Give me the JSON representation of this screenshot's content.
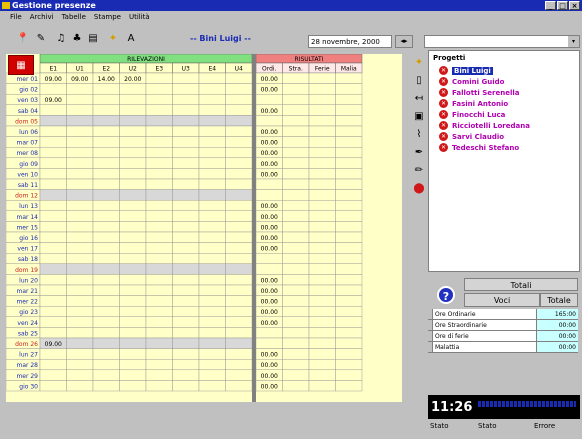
{
  "window": {
    "title": "Gestione presenze",
    "controls": [
      "_",
      "□",
      "×"
    ]
  },
  "menu": [
    "File",
    "Archivi",
    "Tabelle",
    "Stampe",
    "Utilità"
  ],
  "toolbar": {
    "user_label": "-- Bini Luigi --",
    "date_value": "28 novembre, 2000",
    "spin_label": "◂▸",
    "combo_arrow": "▾",
    "icons": [
      "pin-icon",
      "tag-icon",
      "bell-icon",
      "car-icon",
      "printer-icon",
      "star-icon",
      "text-icon"
    ]
  },
  "grid": {
    "group_headers": [
      "RILEVAZIONI",
      "RISULTATI"
    ],
    "columns": [
      "E1",
      "U1",
      "E2",
      "U2",
      "E3",
      "U3",
      "E4",
      "U4",
      "Ordi.",
      "Stra.",
      "Ferie",
      "Malia"
    ],
    "rows": [
      {
        "day": "mer 01",
        "cells": [
          "09.00",
          "09.00",
          "14.00",
          "20.00",
          "",
          "",
          "",
          "",
          "00.00",
          "",
          "",
          ""
        ],
        "holiday": false
      },
      {
        "day": "gio 02",
        "cells": [
          "",
          "",
          "",
          "",
          "",
          "",
          "",
          "",
          "00.00",
          "",
          "",
          ""
        ],
        "holiday": false
      },
      {
        "day": "ven 03",
        "cells": [
          "09.00",
          "",
          "",
          "",
          "",
          "",
          "",
          "",
          "",
          "",
          "",
          ""
        ],
        "holiday": false
      },
      {
        "day": "sab 04",
        "cells": [
          "",
          "",
          "",
          "",
          "",
          "",
          "",
          "",
          "00.00",
          "",
          "",
          ""
        ],
        "holiday": false
      },
      {
        "day": "dom 05",
        "cells": [
          "",
          "",
          "",
          "",
          "",
          "",
          "",
          "",
          "",
          "",
          "",
          ""
        ],
        "holiday": true
      },
      {
        "day": "lun 06",
        "cells": [
          "",
          "",
          "",
          "",
          "",
          "",
          "",
          "",
          "00.00",
          "",
          "",
          ""
        ],
        "holiday": false
      },
      {
        "day": "mar 07",
        "cells": [
          "",
          "",
          "",
          "",
          "",
          "",
          "",
          "",
          "00.00",
          "",
          "",
          ""
        ],
        "holiday": false
      },
      {
        "day": "mer 08",
        "cells": [
          "",
          "",
          "",
          "",
          "",
          "",
          "",
          "",
          "00.00",
          "",
          "",
          ""
        ],
        "holiday": false
      },
      {
        "day": "gio 09",
        "cells": [
          "",
          "",
          "",
          "",
          "",
          "",
          "",
          "",
          "00.00",
          "",
          "",
          ""
        ],
        "holiday": false
      },
      {
        "day": "ven 10",
        "cells": [
          "",
          "",
          "",
          "",
          "",
          "",
          "",
          "",
          "00.00",
          "",
          "",
          ""
        ],
        "holiday": false
      },
      {
        "day": "sab 11",
        "cells": [
          "",
          "",
          "",
          "",
          "",
          "",
          "",
          "",
          "",
          "",
          "",
          ""
        ],
        "holiday": false
      },
      {
        "day": "dom 12",
        "cells": [
          "",
          "",
          "",
          "",
          "",
          "",
          "",
          "",
          "",
          "",
          "",
          ""
        ],
        "holiday": true
      },
      {
        "day": "lun 13",
        "cells": [
          "",
          "",
          "",
          "",
          "",
          "",
          "",
          "",
          "00.00",
          "",
          "",
          ""
        ],
        "holiday": false
      },
      {
        "day": "mar 14",
        "cells": [
          "",
          "",
          "",
          "",
          "",
          "",
          "",
          "",
          "00.00",
          "",
          "",
          ""
        ],
        "holiday": false
      },
      {
        "day": "mer 15",
        "cells": [
          "",
          "",
          "",
          "",
          "",
          "",
          "",
          "",
          "00.00",
          "",
          "",
          ""
        ],
        "holiday": false
      },
      {
        "day": "gio 16",
        "cells": [
          "",
          "",
          "",
          "",
          "",
          "",
          "",
          "",
          "00.00",
          "",
          "",
          ""
        ],
        "holiday": false
      },
      {
        "day": "ven 17",
        "cells": [
          "",
          "",
          "",
          "",
          "",
          "",
          "",
          "",
          "00.00",
          "",
          "",
          ""
        ],
        "holiday": false
      },
      {
        "day": "sab 18",
        "cells": [
          "",
          "",
          "",
          "",
          "",
          "",
          "",
          "",
          "",
          "",
          "",
          ""
        ],
        "holiday": false
      },
      {
        "day": "dom 19",
        "cells": [
          "",
          "",
          "",
          "",
          "",
          "",
          "",
          "",
          "",
          "",
          "",
          ""
        ],
        "holiday": true
      },
      {
        "day": "lun 20",
        "cells": [
          "",
          "",
          "",
          "",
          "",
          "",
          "",
          "",
          "00.00",
          "",
          "",
          ""
        ],
        "holiday": false
      },
      {
        "day": "mar 21",
        "cells": [
          "",
          "",
          "",
          "",
          "",
          "",
          "",
          "",
          "00.00",
          "",
          "",
          ""
        ],
        "holiday": false
      },
      {
        "day": "mer 22",
        "cells": [
          "",
          "",
          "",
          "",
          "",
          "",
          "",
          "",
          "00.00",
          "",
          "",
          ""
        ],
        "holiday": false
      },
      {
        "day": "gio 23",
        "cells": [
          "",
          "",
          "",
          "",
          "",
          "",
          "",
          "",
          "00.00",
          "",
          "",
          ""
        ],
        "holiday": false
      },
      {
        "day": "ven 24",
        "cells": [
          "",
          "",
          "",
          "",
          "",
          "",
          "",
          "",
          "00.00",
          "",
          "",
          ""
        ],
        "holiday": false
      },
      {
        "day": "sab 25",
        "cells": [
          "",
          "",
          "",
          "",
          "",
          "",
          "",
          "",
          "",
          "",
          "",
          ""
        ],
        "holiday": false
      },
      {
        "day": "dom 26",
        "cells": [
          "09.00",
          "",
          "",
          "",
          "",
          "",
          "",
          "",
          "",
          "",
          "",
          ""
        ],
        "holiday": true
      },
      {
        "day": "lun 27",
        "cells": [
          "",
          "",
          "",
          "",
          "",
          "",
          "",
          "",
          "00.00",
          "",
          "",
          ""
        ],
        "holiday": false
      },
      {
        "day": "mar 28",
        "cells": [
          "",
          "",
          "",
          "",
          "",
          "",
          "",
          "",
          "00.00",
          "",
          "",
          ""
        ],
        "holiday": false
      },
      {
        "day": "mer 29",
        "cells": [
          "",
          "",
          "",
          "",
          "",
          "",
          "",
          "",
          "00.00",
          "",
          "",
          ""
        ],
        "holiday": false
      },
      {
        "day": "gio 30",
        "cells": [
          "",
          "",
          "",
          "",
          "",
          "",
          "",
          "",
          "00.00",
          "",
          "",
          ""
        ],
        "holiday": false
      }
    ]
  },
  "projects": {
    "root": "Progetti",
    "items": [
      "Bini Luigi",
      "Comini Guido",
      "Fallotti Serenella",
      "Fasini Antonio",
      "Finocchi Luca",
      "Ricciotelli Loredana",
      "Sarvi Claudio",
      "Tedeschi Stefano"
    ],
    "selected": 0
  },
  "totals": {
    "title": "Totali",
    "header_voci": "Voci",
    "header_totale": "Totale",
    "help_glyph": "?",
    "rows": [
      {
        "voce": "Ore Ordinarie",
        "totale": "165:00"
      },
      {
        "voce": "Ore Straordinarie",
        "totale": "00:00"
      },
      {
        "voce": "Ore di ferie",
        "totale": "00:00"
      },
      {
        "voce": "Malattia",
        "totale": "00:00"
      }
    ]
  },
  "clock": "11:26",
  "status": [
    "Stato",
    "Stato",
    "Errore"
  ],
  "colors": {
    "titlebar": "#1a2bb3",
    "grid_bg": "#ffffc8",
    "header_green": "#80e080",
    "header_red": "#f08080",
    "holiday": "#cc2020",
    "day_text": "#1a2bb3"
  }
}
